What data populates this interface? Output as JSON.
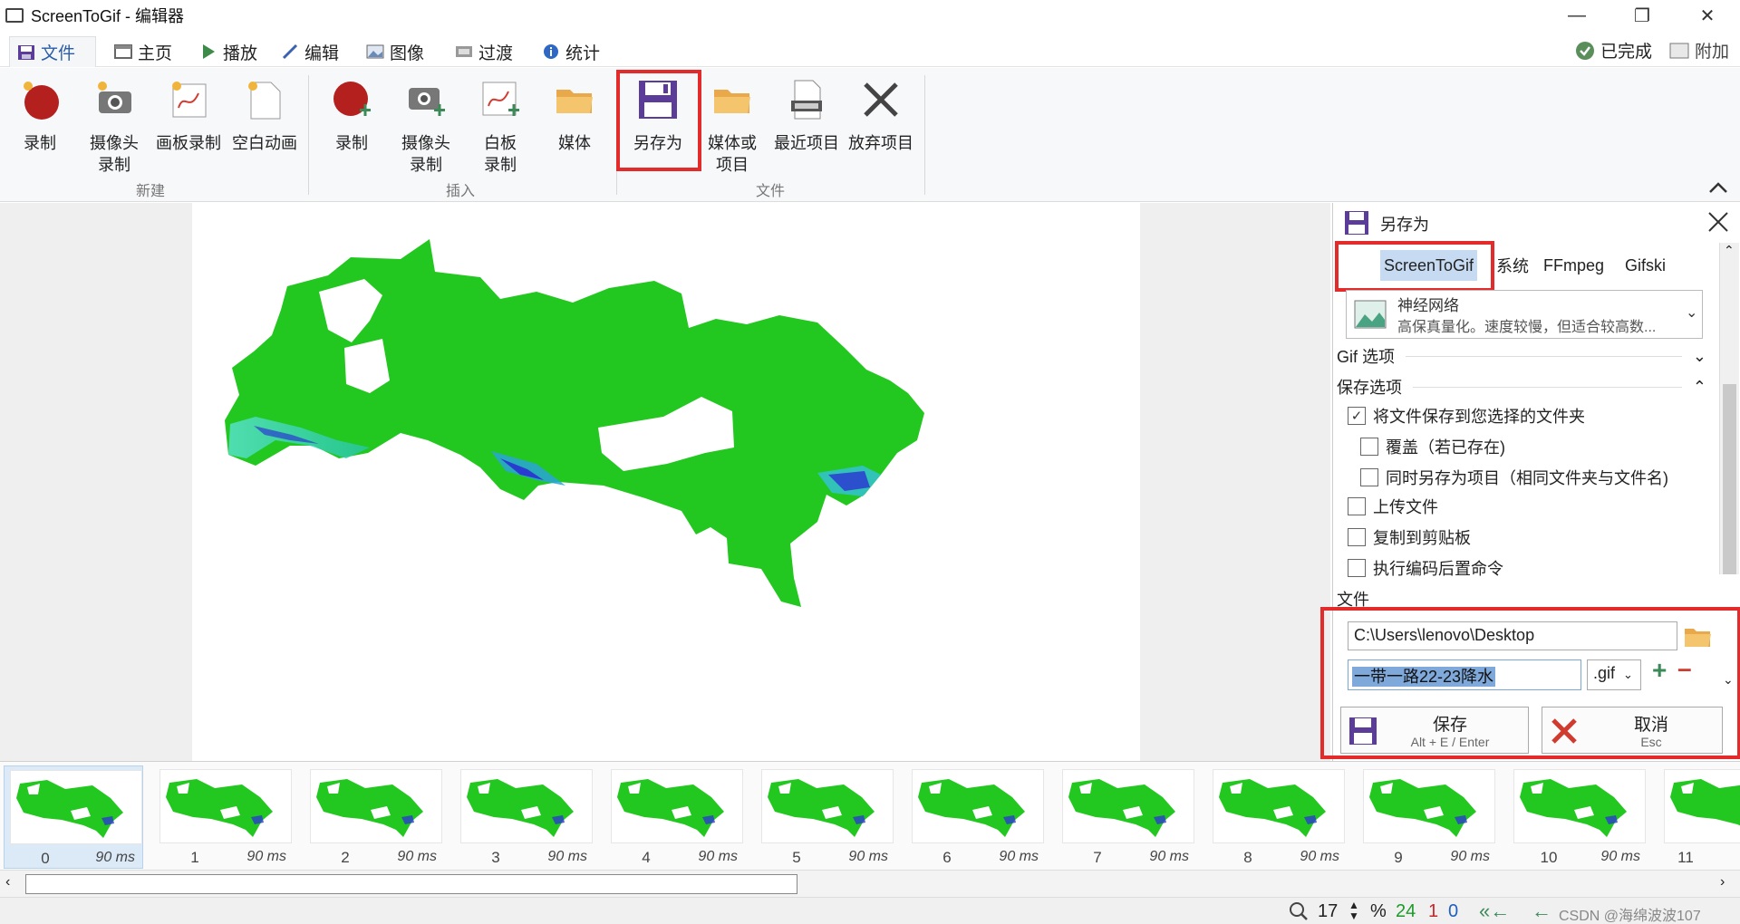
{
  "window": {
    "title": "ScreenToGif - 编辑器"
  },
  "tabs": [
    {
      "label": "文件",
      "icon": "floppy-icon"
    },
    {
      "label": "主页",
      "icon": "home-icon"
    },
    {
      "label": "播放",
      "icon": "play-icon"
    },
    {
      "label": "编辑",
      "icon": "pencil-icon"
    },
    {
      "label": "图像",
      "icon": "image-icon"
    },
    {
      "label": "过渡",
      "icon": "transition-icon"
    },
    {
      "label": "统计",
      "icon": "info-icon"
    }
  ],
  "header_right": {
    "done": "已完成",
    "attach": "附加"
  },
  "ribbon": {
    "group_new": {
      "label": "新建",
      "buttons": [
        "录制",
        "摄像头\n录制",
        "画板录制",
        "空白动画"
      ]
    },
    "group_insert": {
      "label": "插入",
      "buttons": [
        "录制",
        "摄像头\n录制",
        "白板\n录制",
        "媒体"
      ]
    },
    "group_file": {
      "label": "文件",
      "buttons": [
        "另存为",
        "媒体或\n项目",
        "最近项目",
        "放弃项目"
      ]
    },
    "b_new_record_1": "录制",
    "b_new_cam_1": "摄像头",
    "b_new_cam_2": "录制",
    "b_new_board": "画板录制",
    "b_new_blank": "空白动画",
    "b_ins_record": "录制",
    "b_ins_cam_1": "摄像头",
    "b_ins_cam_2": "录制",
    "b_ins_wb_1": "白板",
    "b_ins_wb_2": "录制",
    "b_ins_media": "媒体",
    "b_saveas": "另存为",
    "b_media_1": "媒体或",
    "b_media_2": "项目",
    "b_recent": "最近项目",
    "b_discard": "放弃项目"
  },
  "side_panel": {
    "title": "另存为",
    "encoders": [
      "ScreenToGif",
      "系统",
      "FFmpeg",
      "Gifski"
    ],
    "preset": {
      "name": "神经网络",
      "desc": "高保真量化。速度较慢，但适合较高数..."
    },
    "section_gif": "Gif 选项",
    "section_save": "保存选项",
    "options": [
      {
        "label": "将文件保存到您选择的文件夹",
        "checked": true
      },
      {
        "label": "覆盖（若已存在)",
        "checked": false
      },
      {
        "label": "同时另存为项目（相同文件夹与文件名)",
        "checked": false
      },
      {
        "label": "上传文件",
        "checked": false
      },
      {
        "label": "复制到剪贴板",
        "checked": false
      },
      {
        "label": "执行编码后置命令",
        "checked": false
      }
    ],
    "section_file": "文件",
    "folder": "C:\\Users\\lenovo\\Desktop",
    "filename": "一带一路22-23降水",
    "extension": ".gif",
    "save_label": "保存",
    "save_shortcut": "Alt + E / Enter",
    "cancel_label": "取消",
    "cancel_shortcut": "Esc"
  },
  "frames": [
    {
      "n": "0",
      "ms": "90 ms"
    },
    {
      "n": "1",
      "ms": "90 ms"
    },
    {
      "n": "2",
      "ms": "90 ms"
    },
    {
      "n": "3",
      "ms": "90 ms"
    },
    {
      "n": "4",
      "ms": "90 ms"
    },
    {
      "n": "5",
      "ms": "90 ms"
    },
    {
      "n": "6",
      "ms": "90 ms"
    },
    {
      "n": "7",
      "ms": "90 ms"
    },
    {
      "n": "8",
      "ms": "90 ms"
    },
    {
      "n": "9",
      "ms": "90 ms"
    },
    {
      "n": "10",
      "ms": "90 ms"
    },
    {
      "n": "11",
      "ms": ""
    }
  ],
  "status": {
    "zoom": "17",
    "zoom_unit": "%",
    "count_total": "24",
    "count_selected": "1",
    "count_current": "0",
    "watermark": "CSDN @海绵波波107"
  },
  "colors": {
    "accent": "#2a5ca8",
    "highlight_red": "#e32b2b",
    "map_green": "#22c71f"
  }
}
